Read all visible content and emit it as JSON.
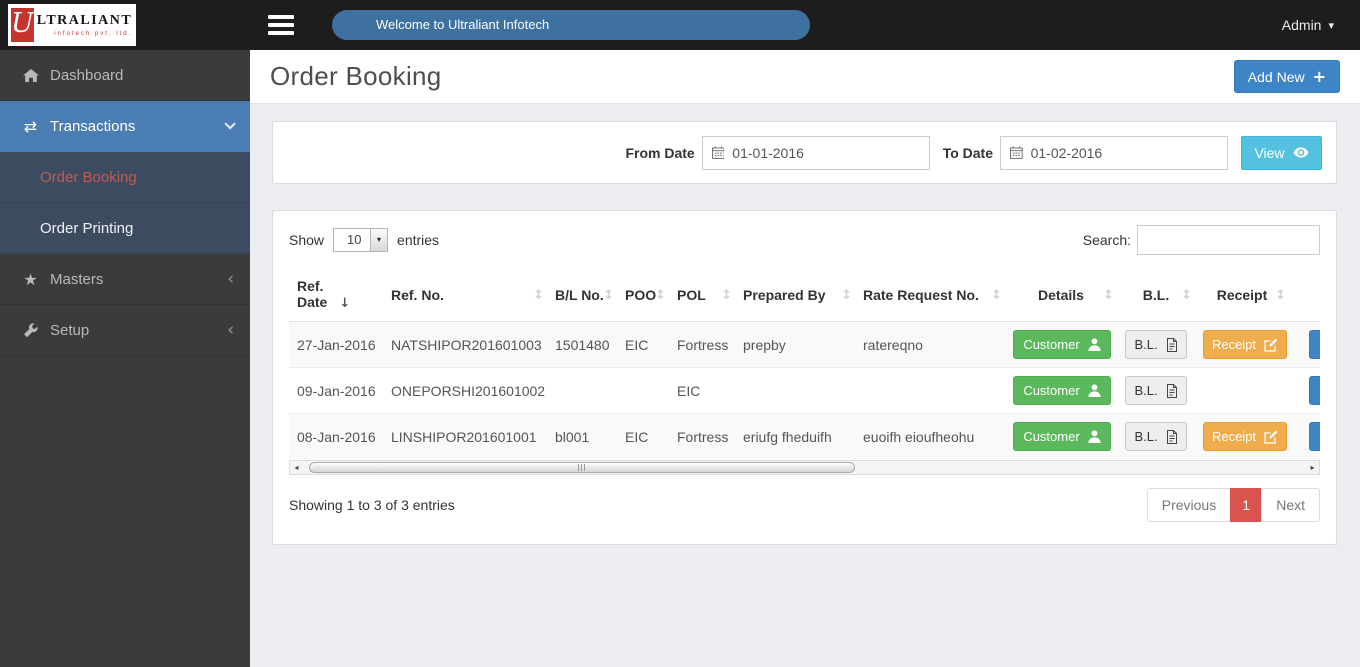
{
  "colors": {
    "primary_blue": "#3d85c6",
    "info_cyan": "#55c1e1",
    "success_green": "#5cb85c",
    "warning_orange": "#f0ad4e",
    "danger_red": "#d9534f",
    "sidebar_active_blue": "#4a7db3",
    "brand_red": "#c6342e",
    "topbar_dark": "#1d1d1d"
  },
  "topbar": {
    "logo": {
      "initial": "U",
      "name": "LTRALIANT",
      "tagline": "infotech pvt. ltd."
    },
    "welcome_text": "Welcome to Ultraliant Infotech",
    "user_label": "Admin"
  },
  "sidebar": {
    "items": [
      {
        "label": "Dashboard",
        "icon": "home-icon",
        "active": false
      },
      {
        "label": "Transactions",
        "icon": "exchange-icon",
        "active": true,
        "expanded": true
      },
      {
        "label": "Order Booking",
        "parent": "Transactions",
        "current": true
      },
      {
        "label": "Order Printing",
        "parent": "Transactions",
        "current": false
      },
      {
        "label": "Masters",
        "icon": "star-icon",
        "active": false
      },
      {
        "label": "Setup",
        "icon": "wrench-icon",
        "active": false
      }
    ]
  },
  "page": {
    "title": "Order Booking",
    "add_new_label": "Add New"
  },
  "filter": {
    "from_label": "From Date",
    "from_value": "01-01-2016",
    "to_label": "To Date",
    "to_value": "01-02-2016",
    "view_label": "View"
  },
  "table": {
    "show_label": "Show",
    "page_size": "10",
    "entries_label": "entries",
    "search_label": "Search:",
    "search_value": "",
    "columns": [
      "Ref. Date",
      "Ref. No.",
      "B/L No.",
      "POO",
      "POL",
      "Prepared By",
      "Rate Request No.",
      "Details",
      "B.L.",
      "Receipt"
    ],
    "sorted_column": "Ref. Date",
    "buttons": {
      "customer": "Customer",
      "bl": "B.L.",
      "receipt": "Receipt"
    },
    "rows": [
      {
        "ref_date": "27-Jan-2016",
        "ref_no": "NATSHIPOR201601003",
        "bl_no": "1501480",
        "poo": "EIC",
        "pol": "Fortress",
        "prepared_by": "prepby",
        "rate_request_no": "ratereqno"
      },
      {
        "ref_date": "09-Jan-2016",
        "ref_no": "ONEPORSHI201601002",
        "bl_no": "",
        "poo": "",
        "pol": "EIC",
        "prepared_by": "",
        "rate_request_no": ""
      },
      {
        "ref_date": "08-Jan-2016",
        "ref_no": "LINSHIPOR201601001",
        "bl_no": "bl001",
        "poo": "EIC",
        "pol": "Fortress",
        "prepared_by": "eriufg fheduifh",
        "rate_request_no": "euoifh eioufheohu"
      }
    ],
    "summary": "Showing 1 to 3 of 3 entries",
    "pagination": {
      "previous": "Previous",
      "current_page": "1",
      "next": "Next"
    }
  },
  "icons": {
    "exchange": "⇄",
    "star": "★",
    "caret_down": "▾",
    "chevron_left": "‹",
    "sort_desc": "↓",
    "sort_both": "↕",
    "scroll_left": "◂",
    "scroll_right": "▸",
    "plus": "+"
  }
}
